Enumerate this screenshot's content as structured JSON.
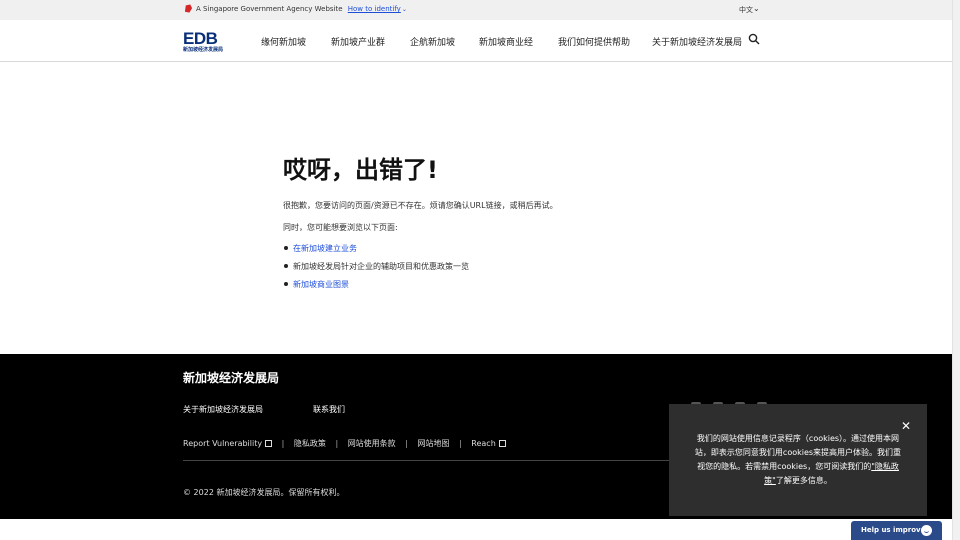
{
  "masthead": {
    "gov_text": "A Singapore Government Agency Website",
    "identify_link": "How to identify",
    "language": "中文"
  },
  "header": {
    "logo_text": "EDB",
    "logo_sub": "新加坡经济发展局",
    "nav": [
      {
        "label": "缘何新加坡"
      },
      {
        "label": "新加坡产业群"
      },
      {
        "label": "企航新加坡"
      },
      {
        "label": "新加坡商业经"
      },
      {
        "label": "我们如何提供帮助"
      },
      {
        "label": "关于新加坡经济发展局"
      }
    ]
  },
  "main": {
    "title": "哎呀，出错了!",
    "message": "很抱歉，您要访问的页面/资源已不存在。烦请您确认URL链接，或稍后再试。",
    "intro": "同时，您可能想要浏览以下页面:",
    "links": [
      {
        "label": "在新加坡建立业务"
      },
      {
        "label": "新加坡经发局针对企业的辅助项目和优惠政策一览"
      },
      {
        "label": "新加坡商业图景"
      }
    ]
  },
  "footer": {
    "title": "新加坡经济发展局",
    "links": [
      {
        "label": "关于新加坡经济发展局"
      },
      {
        "label": "联系我们"
      }
    ],
    "legal": [
      {
        "label": "Report Vulnerability"
      },
      {
        "label": "隐私政策"
      },
      {
        "label": "网站使用条款"
      },
      {
        "label": "网站地图"
      },
      {
        "label": "Reach"
      }
    ],
    "copyright": "© 2022 新加坡经济发展局。保留所有权利。"
  },
  "cookie": {
    "text": "我们的网站使用信息记录程序（cookies）。通过使用本网站，即表示您同意我们用cookies来提高用户体验。我们重视您的隐私。若需禁用cookies，您可阅读我们的",
    "policy_link": "\"隐私政策\"",
    "text_end": "了解更多信息。"
  },
  "feedback": {
    "label": "Help us improve"
  },
  "colors": {
    "link": "#1d4ed8",
    "brand": "#0a2f7a",
    "footer_bg": "#000000",
    "cookie_bg": "#2e2e2e",
    "feedback_bg": "#2b4a8a"
  }
}
